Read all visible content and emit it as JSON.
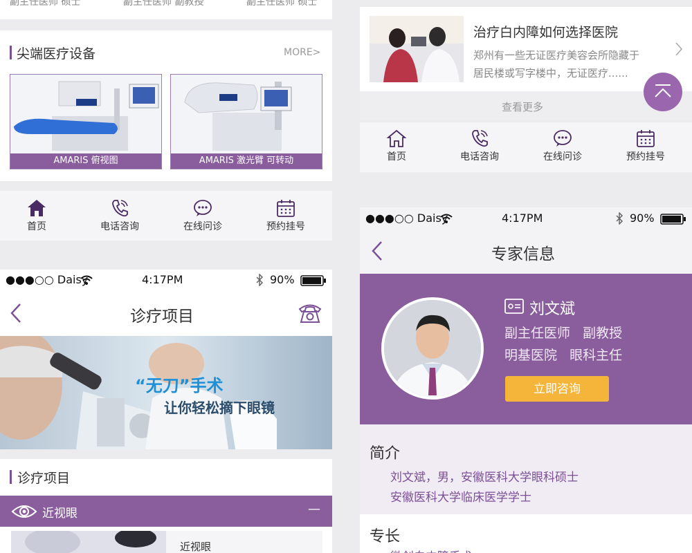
{
  "left": {
    "cut_row": [
      "副主任医师 硕士",
      "副主任医师 副教授",
      "副主任医师 硕士"
    ],
    "equipment": {
      "title": "尖端医疗设备",
      "more": "MORE>",
      "items": [
        {
          "caption": "AMARIS 俯视图"
        },
        {
          "caption": "AMARIS 激光臂 可转动"
        }
      ]
    },
    "tabbar": [
      "首页",
      "电话咨询",
      "在线问诊",
      "预约挂号"
    ],
    "status": {
      "carrier": "●●●○○ Daisy",
      "time": "4:17PM",
      "battery": "90%"
    },
    "nav": {
      "title": "诊疗项目"
    },
    "banner": {
      "line1": "“无刀”手术",
      "line2": "让你轻松摘下眼镜"
    },
    "projects": {
      "title": "诊疗项目",
      "accordion": {
        "label": "近视眼",
        "toggle": "—"
      },
      "item_title": "近视眼"
    }
  },
  "right": {
    "article": {
      "title": "治疗白内障如何选择医院",
      "desc_line1": "郑州有一些无证医疗美容会所隐藏于",
      "desc_line2": "居民楼或写字楼中，无证医疗......"
    },
    "see_more": "查看更多",
    "tabbar": [
      "首页",
      "电话咨询",
      "在线问诊",
      "预约挂号"
    ],
    "status": {
      "carrier": "●●●○○ Daisy",
      "time": "4:17PM",
      "battery": "90%"
    },
    "nav": {
      "title": "专家信息"
    },
    "doctor": {
      "name": "刘文斌",
      "title": "副主任医师   副教授",
      "hospital": "明基医院   眼科主任",
      "consult": "立即咨询"
    },
    "intro": {
      "heading": "简介",
      "line1": "刘文斌，男，安徽医科大学眼科硕士",
      "line2": "安徽医科大学临床医学学士"
    },
    "specialty": {
      "heading": "专长",
      "line1": "微创白内障手术"
    }
  },
  "colors": {
    "brand": "#8a5d9d",
    "accent": "#f5b53b"
  },
  "icons": [
    "home-icon",
    "phone-icon",
    "chat-icon",
    "calendar-icon",
    "back-icon",
    "telephone-icon",
    "eye-icon",
    "chevron-right-icon",
    "arrow-up-icon",
    "id-card-icon",
    "bluetooth-icon",
    "wifi-icon",
    "battery-icon"
  ]
}
